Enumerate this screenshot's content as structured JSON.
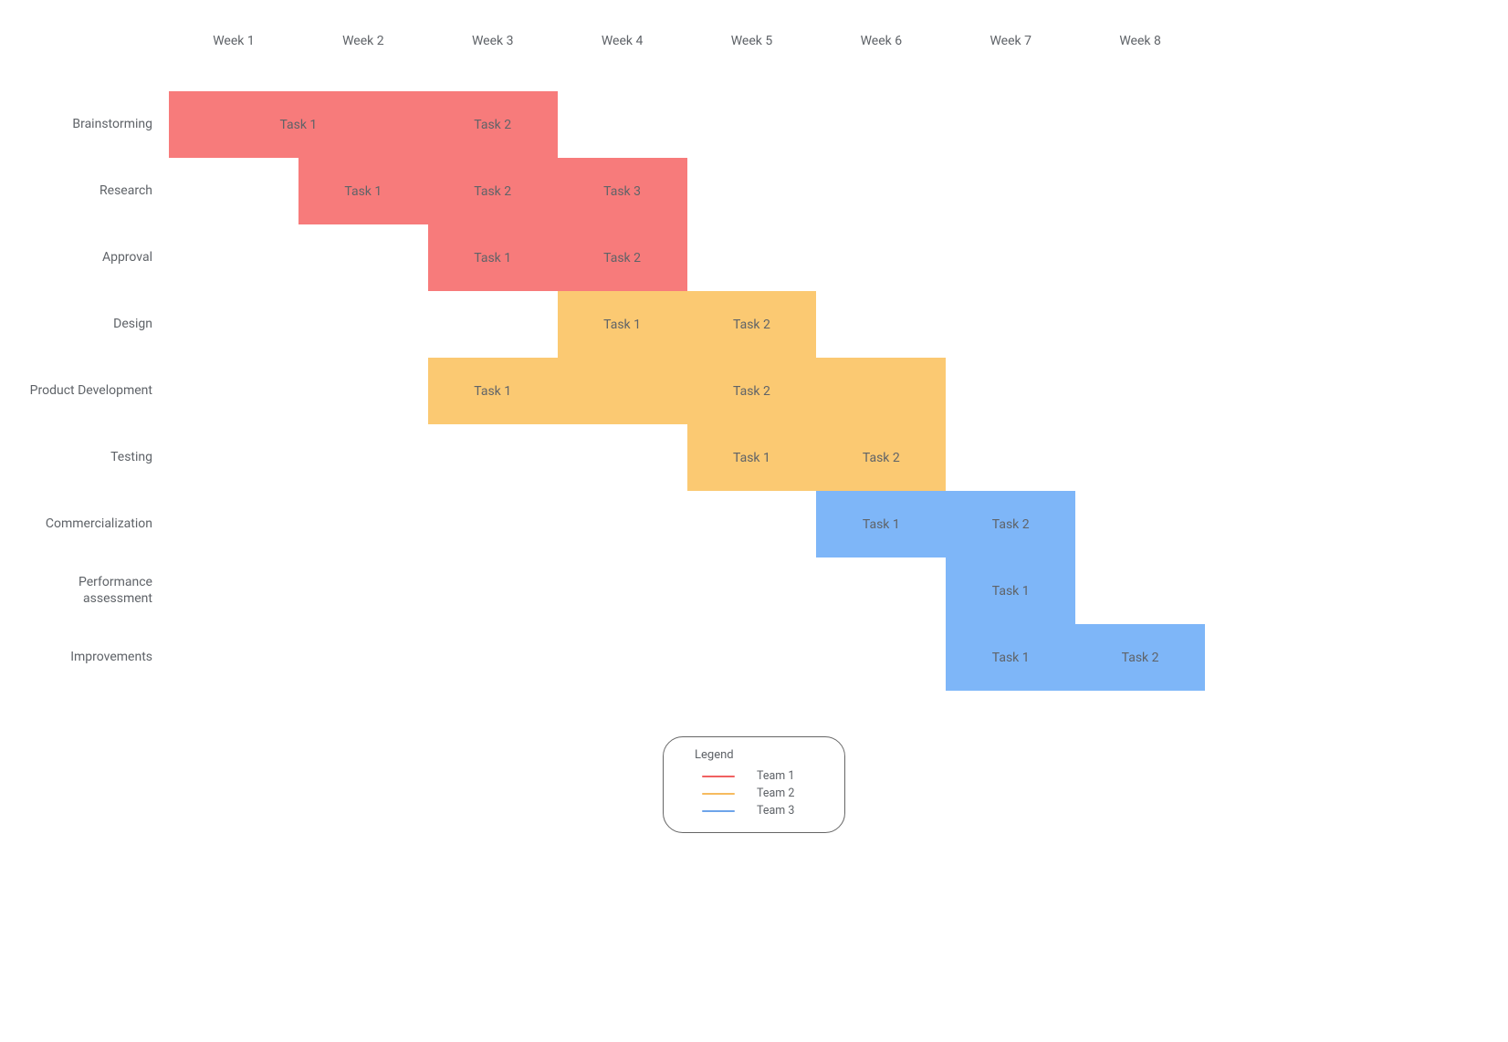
{
  "chart_data": {
    "type": "bar",
    "title": "",
    "x_categories": [
      "Week 1",
      "Week 2",
      "Week 3",
      "Week 4",
      "Week 5",
      "Week 6",
      "Week  7",
      "Week 8"
    ],
    "y_categories": [
      "Brainstorming",
      "Research",
      "Approval",
      "Design",
      "Product Development",
      "Testing",
      "Commercialization",
      "Performance assessment",
      "Improvements"
    ],
    "series": [
      {
        "name": "Team 1",
        "color": "#f77b7b"
      },
      {
        "name": "Team 2",
        "color": "#fbc972"
      },
      {
        "name": "Team 3",
        "color": "#7eb6f8"
      }
    ],
    "rows": [
      {
        "label": "Brainstorming",
        "bars": [
          {
            "label": "Task 1",
            "start": 1,
            "span": 2,
            "team": "team1"
          },
          {
            "label": "Task 2",
            "start": 3,
            "span": 1,
            "team": "team1"
          }
        ]
      },
      {
        "label": "Research",
        "bars": [
          {
            "label": "Task 1",
            "start": 2,
            "span": 1,
            "team": "team1"
          },
          {
            "label": "Task 2",
            "start": 3,
            "span": 1,
            "team": "team1"
          },
          {
            "label": "Task 3",
            "start": 4,
            "span": 1,
            "team": "team1"
          }
        ]
      },
      {
        "label": "Approval",
        "bars": [
          {
            "label": "Task 1",
            "start": 3,
            "span": 1,
            "team": "team1"
          },
          {
            "label": "Task 2",
            "start": 4,
            "span": 1,
            "team": "team1"
          }
        ]
      },
      {
        "label": "Design",
        "bars": [
          {
            "label": "Task 1",
            "start": 4,
            "span": 1,
            "team": "team2"
          },
          {
            "label": "Task 2",
            "start": 5,
            "span": 1,
            "team": "team2"
          }
        ]
      },
      {
        "label": "Product Development",
        "bars": [
          {
            "label": "Task 1",
            "start": 3,
            "span": 1,
            "team": "team2"
          },
          {
            "label": "Task 2",
            "start": 4,
            "span": 3,
            "team": "team2"
          }
        ]
      },
      {
        "label": "Testing",
        "bars": [
          {
            "label": "Task 1",
            "start": 5,
            "span": 1,
            "team": "team2"
          },
          {
            "label": "Task 2",
            "start": 6,
            "span": 1,
            "team": "team2"
          }
        ]
      },
      {
        "label": "Commercialization",
        "bars": [
          {
            "label": "Task 1",
            "start": 6,
            "span": 1,
            "team": "team3"
          },
          {
            "label": "Task 2",
            "start": 7,
            "span": 1,
            "team": "team3"
          }
        ]
      },
      {
        "label": "Performance assessment",
        "bars": [
          {
            "label": "Task 1",
            "start": 7,
            "span": 1,
            "team": "team3"
          }
        ]
      },
      {
        "label": "Improvements",
        "bars": [
          {
            "label": "Task 1",
            "start": 7,
            "span": 1,
            "team": "team3"
          },
          {
            "label": "Task 2",
            "start": 8,
            "span": 1,
            "team": "team3"
          }
        ]
      }
    ]
  },
  "legend": {
    "title": "Legend",
    "items": [
      {
        "label": "Team 1"
      },
      {
        "label": "Team 2"
      },
      {
        "label": "Team 3"
      }
    ]
  }
}
